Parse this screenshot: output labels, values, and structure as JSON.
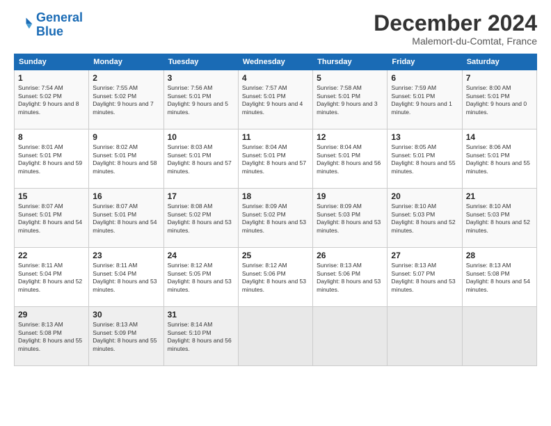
{
  "logo": {
    "line1": "General",
    "line2": "Blue"
  },
  "title": "December 2024",
  "subtitle": "Malemort-du-Comtat, France",
  "weekdays": [
    "Sunday",
    "Monday",
    "Tuesday",
    "Wednesday",
    "Thursday",
    "Friday",
    "Saturday"
  ],
  "weeks": [
    [
      {
        "day": "1",
        "sunrise": "7:54 AM",
        "sunset": "5:02 PM",
        "daylight": "9 hours and 8 minutes."
      },
      {
        "day": "2",
        "sunrise": "7:55 AM",
        "sunset": "5:02 PM",
        "daylight": "9 hours and 7 minutes."
      },
      {
        "day": "3",
        "sunrise": "7:56 AM",
        "sunset": "5:01 PM",
        "daylight": "9 hours and 5 minutes."
      },
      {
        "day": "4",
        "sunrise": "7:57 AM",
        "sunset": "5:01 PM",
        "daylight": "9 hours and 4 minutes."
      },
      {
        "day": "5",
        "sunrise": "7:58 AM",
        "sunset": "5:01 PM",
        "daylight": "9 hours and 3 minutes."
      },
      {
        "day": "6",
        "sunrise": "7:59 AM",
        "sunset": "5:01 PM",
        "daylight": "9 hours and 1 minute."
      },
      {
        "day": "7",
        "sunrise": "8:00 AM",
        "sunset": "5:01 PM",
        "daylight": "9 hours and 0 minutes."
      }
    ],
    [
      {
        "day": "8",
        "sunrise": "8:01 AM",
        "sunset": "5:01 PM",
        "daylight": "8 hours and 59 minutes."
      },
      {
        "day": "9",
        "sunrise": "8:02 AM",
        "sunset": "5:01 PM",
        "daylight": "8 hours and 58 minutes."
      },
      {
        "day": "10",
        "sunrise": "8:03 AM",
        "sunset": "5:01 PM",
        "daylight": "8 hours and 57 minutes."
      },
      {
        "day": "11",
        "sunrise": "8:04 AM",
        "sunset": "5:01 PM",
        "daylight": "8 hours and 57 minutes."
      },
      {
        "day": "12",
        "sunrise": "8:04 AM",
        "sunset": "5:01 PM",
        "daylight": "8 hours and 56 minutes."
      },
      {
        "day": "13",
        "sunrise": "8:05 AM",
        "sunset": "5:01 PM",
        "daylight": "8 hours and 55 minutes."
      },
      {
        "day": "14",
        "sunrise": "8:06 AM",
        "sunset": "5:01 PM",
        "daylight": "8 hours and 55 minutes."
      }
    ],
    [
      {
        "day": "15",
        "sunrise": "8:07 AM",
        "sunset": "5:01 PM",
        "daylight": "8 hours and 54 minutes."
      },
      {
        "day": "16",
        "sunrise": "8:07 AM",
        "sunset": "5:01 PM",
        "daylight": "8 hours and 54 minutes."
      },
      {
        "day": "17",
        "sunrise": "8:08 AM",
        "sunset": "5:02 PM",
        "daylight": "8 hours and 53 minutes."
      },
      {
        "day": "18",
        "sunrise": "8:09 AM",
        "sunset": "5:02 PM",
        "daylight": "8 hours and 53 minutes."
      },
      {
        "day": "19",
        "sunrise": "8:09 AM",
        "sunset": "5:03 PM",
        "daylight": "8 hours and 53 minutes."
      },
      {
        "day": "20",
        "sunrise": "8:10 AM",
        "sunset": "5:03 PM",
        "daylight": "8 hours and 52 minutes."
      },
      {
        "day": "21",
        "sunrise": "8:10 AM",
        "sunset": "5:03 PM",
        "daylight": "8 hours and 52 minutes."
      }
    ],
    [
      {
        "day": "22",
        "sunrise": "8:11 AM",
        "sunset": "5:04 PM",
        "daylight": "8 hours and 52 minutes."
      },
      {
        "day": "23",
        "sunrise": "8:11 AM",
        "sunset": "5:04 PM",
        "daylight": "8 hours and 53 minutes."
      },
      {
        "day": "24",
        "sunrise": "8:12 AM",
        "sunset": "5:05 PM",
        "daylight": "8 hours and 53 minutes."
      },
      {
        "day": "25",
        "sunrise": "8:12 AM",
        "sunset": "5:06 PM",
        "daylight": "8 hours and 53 minutes."
      },
      {
        "day": "26",
        "sunrise": "8:13 AM",
        "sunset": "5:06 PM",
        "daylight": "8 hours and 53 minutes."
      },
      {
        "day": "27",
        "sunrise": "8:13 AM",
        "sunset": "5:07 PM",
        "daylight": "8 hours and 53 minutes."
      },
      {
        "day": "28",
        "sunrise": "8:13 AM",
        "sunset": "5:08 PM",
        "daylight": "8 hours and 54 minutes."
      }
    ],
    [
      {
        "day": "29",
        "sunrise": "8:13 AM",
        "sunset": "5:08 PM",
        "daylight": "8 hours and 55 minutes."
      },
      {
        "day": "30",
        "sunrise": "8:13 AM",
        "sunset": "5:09 PM",
        "daylight": "8 hours and 55 minutes."
      },
      {
        "day": "31",
        "sunrise": "8:14 AM",
        "sunset": "5:10 PM",
        "daylight": "8 hours and 56 minutes."
      },
      null,
      null,
      null,
      null
    ]
  ]
}
